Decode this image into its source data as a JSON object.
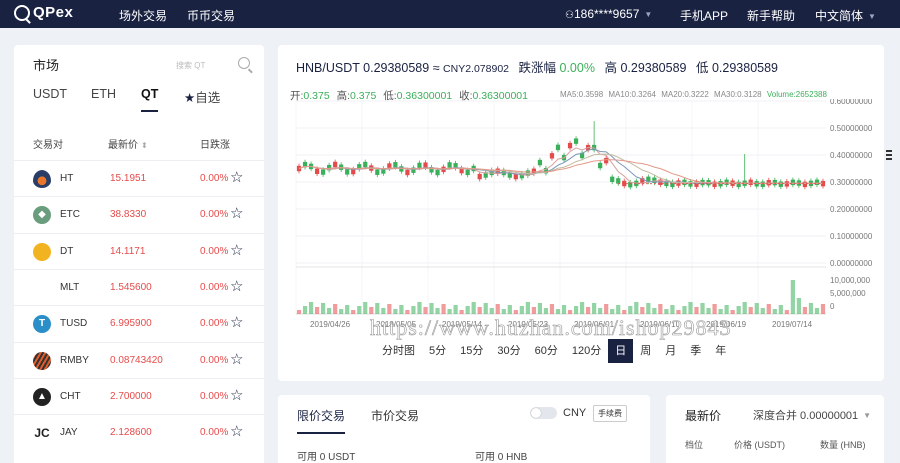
{
  "nav": {
    "logo": "QPex",
    "otc": "场外交易",
    "coin": "币币交易",
    "user": "186****9657",
    "app": "手机APP",
    "help": "新手帮助",
    "lang": "中文简体"
  },
  "market": {
    "title": "市场",
    "search_placeholder": "搜索 QT",
    "tabs": [
      "USDT",
      "ETH",
      "QT",
      "自选"
    ],
    "active_tab": "QT",
    "headers": {
      "pair": "交易对",
      "price": "最新价",
      "change": "日跌涨"
    },
    "rows": [
      {
        "name": "HT",
        "price": "15.1951",
        "change": "0.00%",
        "icon": "ht-flame-icon"
      },
      {
        "name": "ETC",
        "price": "38.8330",
        "change": "0.00%",
        "icon": "etc-diamond-icon"
      },
      {
        "name": "DT",
        "price": "14.1171",
        "change": "0.00%",
        "icon": "dt-bird-icon"
      },
      {
        "name": "MLT",
        "price": "1.545600",
        "change": "0.00%",
        "icon": "mlt-icon"
      },
      {
        "name": "TUSD",
        "price": "6.995900",
        "change": "0.00%",
        "icon": "tusd-icon"
      },
      {
        "name": "RMBY",
        "price": "0.08743420",
        "change": "0.00%",
        "icon": "rmby-icon"
      },
      {
        "name": "CHT",
        "price": "2.700000",
        "change": "0.00%",
        "icon": "cht-icon"
      },
      {
        "name": "JAY",
        "price": "2.128600",
        "change": "0.00%",
        "icon": "jay-icon"
      }
    ]
  },
  "ticker": {
    "pair": "HNB/USDT",
    "price": "0.29380589",
    "approx": "≈",
    "cny": "CNY2.078902",
    "change_label": "跌涨幅",
    "change": "0.00%",
    "high_label": "高",
    "high": "0.29380589",
    "low_label": "低",
    "low": "0.29380589"
  },
  "ohlc": {
    "open_label": "开:",
    "open": "0.375",
    "high_label": "高:",
    "high": "0.375",
    "low_label": "低:",
    "low": "0.36300001",
    "close_label": "收:",
    "close": "0.36300001",
    "ma5": "MA5:0.3598",
    "ma10": "MA10:0.3264",
    "ma20": "MA20:0.3222",
    "ma30": "MA30:0.3128",
    "volume": "Volume:2652388"
  },
  "chart_data": {
    "type": "candlestick",
    "price_axis": [
      "0.60000000",
      "0.50000000",
      "0.40000000",
      "0.30000000",
      "0.20000000",
      "0.10000000",
      "0.00000000"
    ],
    "volume_axis": [
      "10,000,000",
      "5,000,000",
      "0"
    ],
    "x_labels": [
      "2019/04/26",
      "2019/05/05",
      "2019/05/14",
      "2019/05/23",
      "2019/06/01",
      "2019/06/10",
      "2019/06/19",
      "2019/07/14"
    ],
    "ylim": [
      0,
      0.6
    ],
    "colors": {
      "up": "#3bb05a",
      "down": "#e64b4b"
    }
  },
  "periods": [
    "分时图",
    "5分",
    "15分",
    "30分",
    "60分",
    "120分",
    "日",
    "周",
    "月",
    "季",
    "年"
  ],
  "active_period": "日",
  "order": {
    "tab_limit": "限价交易",
    "tab_market": "市价交易",
    "currency": "CNY",
    "fee": "手续费",
    "avail_label": "可用",
    "avail_usdt": "0 USDT",
    "avail_hnb": "0 HNB"
  },
  "depth": {
    "title": "最新价",
    "merge": "深度合并 0.00000001",
    "headers": [
      "档位",
      "价格 (USDT)",
      "数量 (HNB)"
    ]
  },
  "watermark": "https://www.huzhan.com/ishop29843"
}
